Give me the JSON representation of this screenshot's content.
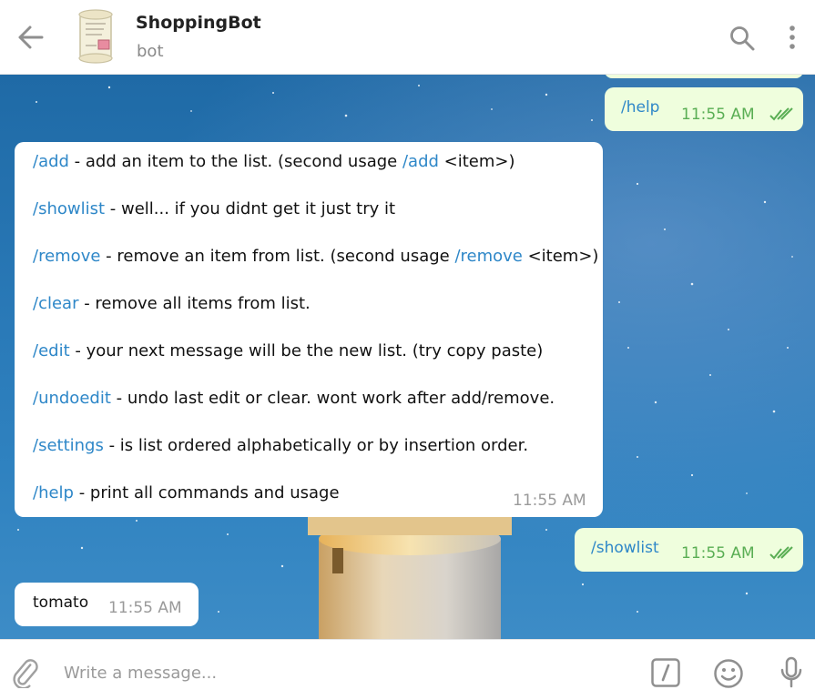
{
  "header": {
    "title": "ShoppingBot",
    "subtitle": "bot",
    "icons": [
      "back-arrow-icon",
      "search-icon",
      "more-vertical-icon"
    ]
  },
  "messages": {
    "help_out": {
      "text": "/help",
      "time": "11:55 AM"
    },
    "help_reply": {
      "lines": [
        {
          "cmd": "/add",
          "text": " - add an item to the list. (second usage ",
          "cmd2": "/add",
          "tail": " <item>)"
        },
        {
          "cmd": "/showlist",
          "text": " - well... if you didnt get it just try it",
          "cmd2": "",
          "tail": ""
        },
        {
          "cmd": "/remove",
          "text": " - remove an item from list. (second usage ",
          "cmd2": "/remove",
          "tail": " <item>)"
        },
        {
          "cmd": "/clear",
          "text": " - remove all items from list.",
          "cmd2": "",
          "tail": ""
        },
        {
          "cmd": "/edit",
          "text": " - your next message will be the new list. (try copy paste)",
          "cmd2": "",
          "tail": ""
        },
        {
          "cmd": "/undoedit",
          "text": " - undo last edit or clear. wont work after add/remove.",
          "cmd2": "",
          "tail": ""
        },
        {
          "cmd": "/settings",
          "text": " - is list ordered alphabetically or by insertion order.",
          "cmd2": "",
          "tail": ""
        },
        {
          "cmd": "/help",
          "text": " - print all commands and usage",
          "cmd2": "",
          "tail": ""
        }
      ],
      "time": "11:55 AM"
    },
    "showlist_out": {
      "text": "/showlist",
      "time": "11:55 AM"
    },
    "tomato_reply": {
      "text": "tomato",
      "time": "11:55 AM"
    }
  },
  "composer": {
    "placeholder": "Write a message...",
    "value": ""
  },
  "colors": {
    "link": "#2e87c8",
    "outgoing_bubble": "#effedd",
    "read_ticks": "#5aae54"
  }
}
